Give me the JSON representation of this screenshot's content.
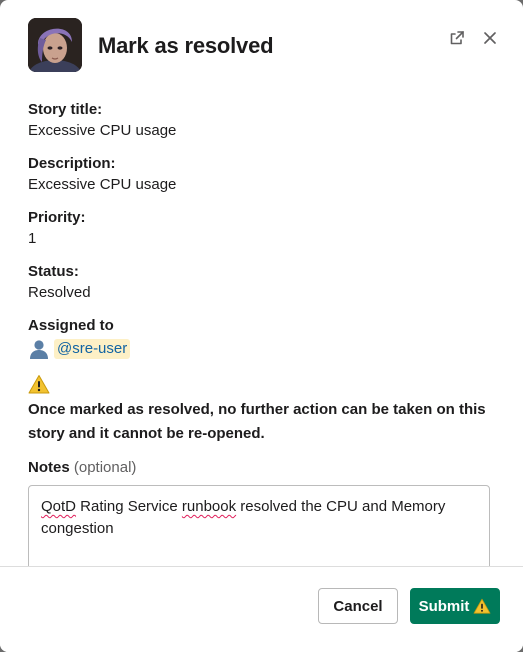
{
  "modal": {
    "title": "Mark as resolved",
    "popout_icon": "external-link-icon",
    "close_icon": "close-icon"
  },
  "fields": [
    {
      "label": "Story title:",
      "value": "Excessive CPU usage"
    },
    {
      "label": "Description:",
      "value": "Excessive CPU usage"
    },
    {
      "label": "Priority:",
      "value": "1"
    },
    {
      "label": "Status:",
      "value": "Resolved"
    }
  ],
  "assigned": {
    "label": "Assigned to",
    "icon": "bust-in-silhouette-icon",
    "mention": "@sre-user"
  },
  "warning": {
    "icon": "warning-icon",
    "text": "Once marked as resolved, no further action can be taken on this story and it cannot be re-opened."
  },
  "notes": {
    "label": "Notes",
    "optional": "(optional)",
    "value_parts": [
      "QotD",
      " Rating Service ",
      "runbook",
      " resolved the CPU and Memory congestion"
    ]
  },
  "footer": {
    "cancel_label": "Cancel",
    "submit_label": "Submit",
    "submit_icon": "warning-icon"
  },
  "colors": {
    "submit_bg": "#007a5a",
    "mention_bg": "#fdf0c6",
    "mention_text": "#1264a3"
  }
}
